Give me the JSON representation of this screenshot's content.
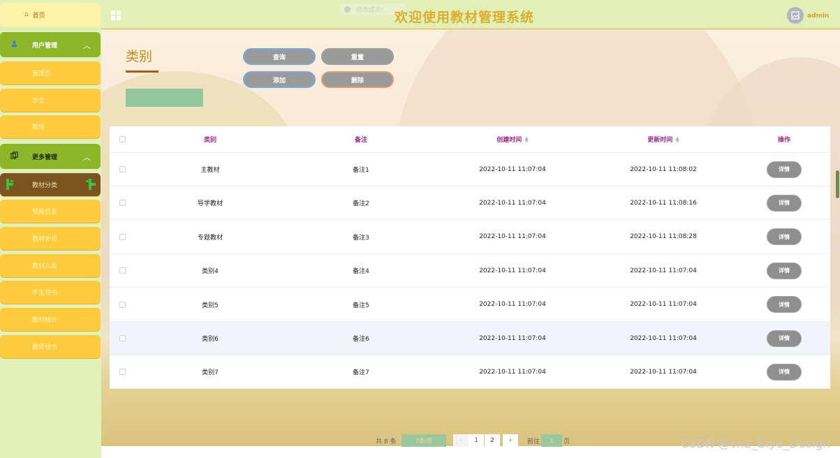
{
  "topbar": {
    "title": "欢迎使用教材管理系统",
    "toast": "修改成功!",
    "user": "admin"
  },
  "sidebar": {
    "home": "首页",
    "groups": [
      {
        "label": "用户管理",
        "items": [
          "管理员",
          "学生",
          "教师"
        ]
      },
      {
        "label": "更多管理",
        "items": [
          "教材分类",
          "预报信息",
          "教材补货",
          "教材入库",
          "学生领书",
          "教材统计",
          "教师领书"
        ]
      }
    ],
    "active_item": "教材分类"
  },
  "page": {
    "title": "类别",
    "buttons": {
      "search": "查询",
      "reset": "重置",
      "add": "添加",
      "delete": "删除"
    }
  },
  "table": {
    "headers": {
      "category": "类别",
      "note": "备注",
      "created": "创建时间",
      "updated": "更新时间",
      "action": "操作"
    },
    "rows": [
      {
        "category": "主教材",
        "note": "备注1",
        "created": "2022-10-11 11:07:04",
        "updated": "2022-10-11 11:08:02",
        "action": "详情"
      },
      {
        "category": "导学教材",
        "note": "备注2",
        "created": "2022-10-11 11:07:04",
        "updated": "2022-10-11 11:08:16",
        "action": "详情"
      },
      {
        "category": "专题教材",
        "note": "备注3",
        "created": "2022-10-11 11:07:04",
        "updated": "2022-10-11 11:08:28",
        "action": "详情"
      },
      {
        "category": "类别4",
        "note": "备注4",
        "created": "2022-10-11 11:07:04",
        "updated": "2022-10-11 11:07:04",
        "action": "详情"
      },
      {
        "category": "类别5",
        "note": "备注5",
        "created": "2022-10-11 11:07:04",
        "updated": "2022-10-11 11:07:04",
        "action": "详情"
      },
      {
        "category": "类别6",
        "note": "备注6",
        "created": "2022-10-11 11:07:04",
        "updated": "2022-10-11 11:07:04",
        "action": "详情"
      },
      {
        "category": "类别7",
        "note": "备注7",
        "created": "2022-10-11 11:07:04",
        "updated": "2022-10-11 11:07:04",
        "action": "详情"
      }
    ]
  },
  "pagination": {
    "total": "共 8 条",
    "page_size": "7条/页",
    "pages": [
      "1",
      "2"
    ],
    "current": "1",
    "goto_label": "前往",
    "goto_value": "1",
    "page_suffix": "页"
  },
  "watermark": "CSDN @vx2_Biye_Design",
  "colors": {
    "sidebar_bg": "#e1f1b8",
    "group_green": "#8bb728",
    "item_yellow": "#fecb3f",
    "active_brown": "#7a531e",
    "title_gold": "#dcae2e"
  }
}
